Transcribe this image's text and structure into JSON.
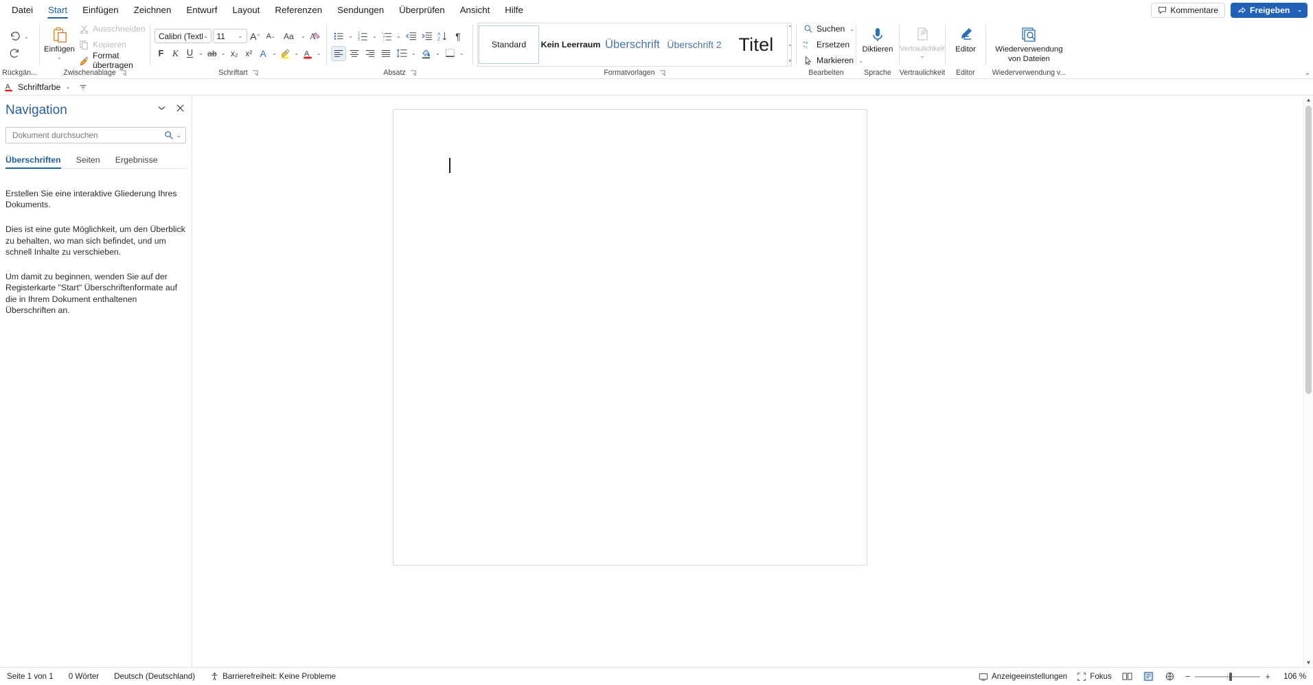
{
  "window": {
    "tabs": [
      {
        "label": "Datei",
        "active": false
      },
      {
        "label": "Start",
        "active": true
      },
      {
        "label": "Einfügen",
        "active": false
      },
      {
        "label": "Zeichnen",
        "active": false
      },
      {
        "label": "Entwurf",
        "active": false
      },
      {
        "label": "Layout",
        "active": false
      },
      {
        "label": "Referenzen",
        "active": false
      },
      {
        "label": "Sendungen",
        "active": false
      },
      {
        "label": "Überprüfen",
        "active": false
      },
      {
        "label": "Ansicht",
        "active": false
      },
      {
        "label": "Hilfe",
        "active": false
      }
    ],
    "comments_label": "Kommentare",
    "share_label": "Freigeben",
    "share_caret": "⌄",
    "accent_blue": "#2161b8",
    "tab_active_color": "#1b5fa8"
  },
  "ribbon": {
    "undo": {
      "group_label": "Rückgän...",
      "undo_icon": "undo-icon",
      "undo_caret": "⌄",
      "redo_icon": "redo-icon"
    },
    "clipboard": {
      "group_label": "Zwischenablage",
      "paste_label": "Einfügen",
      "paste_caret": "⌄",
      "cut_label": "Ausschneiden",
      "copy_label": "Kopieren",
      "format_painter_label": "Format übertragen",
      "dialog_launcher": "⌐"
    },
    "font": {
      "group_label": "Schriftart",
      "font_name": "Calibri (Textkörp",
      "font_size": "11",
      "grow_font": "A",
      "shrink_font": "A",
      "change_case": "Aa",
      "clear_formatting": "A",
      "bold": "F",
      "italic": "K",
      "underline": "U",
      "strikethrough": "ab",
      "subscript": "x₂",
      "superscript": "x²",
      "text_effects": "A",
      "highlight": "A",
      "font_color": "A",
      "dialog_launcher": "⌐"
    },
    "paragraph": {
      "group_label": "Absatz",
      "bullets": "bullets-icon",
      "numbering": "numbering-icon",
      "multilevel": "multilevel-list-icon",
      "decrease_indent": "decrease-indent-icon",
      "increase_indent": "increase-indent-icon",
      "sort": "sort-icon",
      "show_marks": "¶",
      "align_left": "align-left-icon",
      "align_center": "align-center-icon",
      "align_right": "align-right-icon",
      "justify": "justify-icon",
      "line_spacing": "line-spacing-icon",
      "shading": "shading-icon",
      "borders": "borders-icon",
      "dialog_launcher": "⌐"
    },
    "styles": {
      "group_label": "Formatvorlagen",
      "items": [
        {
          "label": "Standard",
          "class": "st-standard",
          "selected": true
        },
        {
          "label": "Kein Leerraum",
          "class": "st-noSpacing",
          "selected": false
        },
        {
          "label": "Überschrift",
          "class": "st-h1",
          "selected": false
        },
        {
          "label": "Überschrift 2",
          "class": "st-h2",
          "selected": false
        },
        {
          "label": "Titel",
          "class": "st-title",
          "selected": false
        }
      ],
      "scroll_up": "⌃",
      "scroll_down": "⌄",
      "more": "⌅",
      "dialog_launcher": "⌐"
    },
    "editing": {
      "group_label": "Bearbeiten",
      "find_label": "Suchen",
      "find_caret": "⌄",
      "replace_label": "Ersetzen",
      "select_label": "Markieren",
      "select_caret": "⌄"
    },
    "voice": {
      "group_label": "Sprache",
      "dictate_label": "Diktieren"
    },
    "sensitivity": {
      "group_label": "Vertraulichkeit",
      "button_label": "Vertraulichkeit",
      "caret": "⌄",
      "disabled": true
    },
    "editor": {
      "group_label": "Editor",
      "button_label": "Editor"
    },
    "reuse": {
      "group_label": "Wiederverwendung v...",
      "button_label_line1": "Wiederverwendung",
      "button_label_line2": "von Dateien"
    },
    "collapse_caret": "⌄"
  },
  "subbar": {
    "font_color_label": "Schriftfarbe",
    "font_color_caret": "⌄",
    "overflow_icon": "overflow-chevron-icon"
  },
  "navigation": {
    "title": "Navigation",
    "collapse_icon": "chevron-down-icon",
    "close_icon": "close-icon",
    "search_placeholder": "Dokument durchsuchen",
    "search_value": "",
    "search_icon": "search-icon",
    "search_caret": "⌄",
    "tabs": [
      {
        "label": "Überschriften",
        "active": true
      },
      {
        "label": "Seiten",
        "active": false
      },
      {
        "label": "Ergebnisse",
        "active": false
      }
    ],
    "paragraphs": [
      "Erstellen Sie eine interaktive Gliederung Ihres Dokuments.",
      "Dies ist eine gute Möglichkeit, um den Überblick zu behalten, wo man sich befindet, und um schnell Inhalte zu verschieben.",
      "Um damit zu beginnen, wenden Sie auf der Registerkarte \"Start\" Überschriftenformate auf die in Ihrem Dokument enthaltenen Überschriften an."
    ]
  },
  "statusbar": {
    "page_info": "Seite 1 von 1",
    "word_count": "0 Wörter",
    "language": "Deutsch (Deutschland)",
    "accessibility": "Barrierefreiheit: Keine Probleme",
    "display_settings": "Anzeigeeinstellungen",
    "focus": "Fokus",
    "zoom_value": "106 %",
    "zoom_out": "−",
    "zoom_in": "+",
    "view_read": "read-mode-icon",
    "view_print": "print-layout-icon",
    "view_web": "web-layout-icon"
  }
}
